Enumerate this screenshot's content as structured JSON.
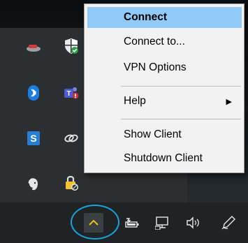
{
  "context_menu": {
    "items": [
      {
        "label": "Connect",
        "highlighted": true,
        "bold": true
      },
      {
        "label": "Connect to..."
      },
      {
        "label": "VPN Options"
      },
      {
        "label": "Help",
        "has_submenu": true
      },
      {
        "label": "Show Client"
      },
      {
        "label": "Shutdown Client"
      }
    ],
    "submenu_arrow": "▶",
    "highlight_color": "#91c9f7"
  },
  "tray_overflow": {
    "icons": [
      "cisco-anyconnect-icon",
      "windows-security-icon",
      "bluetooth-icon",
      "teams-icon",
      "s-app-icon",
      "link-icon",
      "evernote-icon",
      "vpn-lock-icon"
    ]
  },
  "taskbar": {
    "overflow_chevron": "^",
    "icons": [
      "battery-icon",
      "network-icon",
      "volume-icon",
      "pen-icon"
    ]
  }
}
